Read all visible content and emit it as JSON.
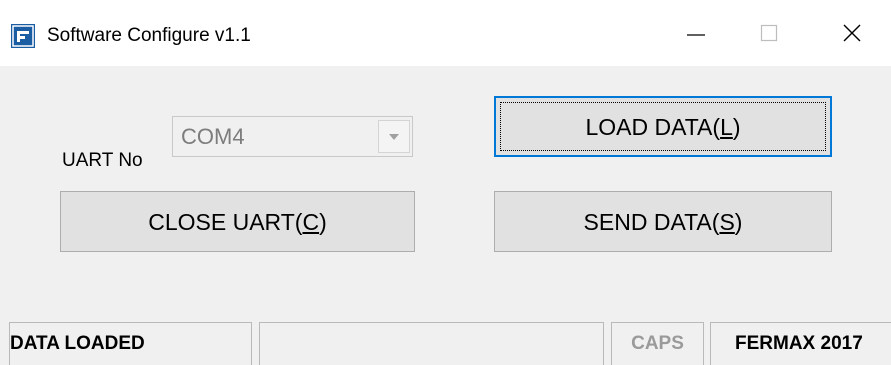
{
  "window": {
    "title": "Software Configure v1.1",
    "icon": "app-icon",
    "controls": {
      "minimize": "minimize-icon",
      "maximize": "maximize-icon",
      "close": "close-icon"
    }
  },
  "form": {
    "uart_label": "UART No",
    "uart_select": {
      "value": "COM4",
      "disabled": true
    },
    "load_button": {
      "prefix": "LOAD DATA(",
      "hotkey": "L",
      "suffix": ")"
    },
    "send_button": {
      "prefix": "SEND DATA(",
      "hotkey": "S",
      "suffix": ")"
    },
    "close_button": {
      "prefix": "CLOSE UART(",
      "hotkey": "C",
      "suffix": ")"
    }
  },
  "statusbar": {
    "status": "DATA LOADED",
    "empty": "",
    "caps": "CAPS",
    "brand": "FERMAX 2017"
  },
  "colors": {
    "accent": "#0078d7",
    "app_icon": "#1a5da3",
    "disabled_text": "#7d7d7d"
  }
}
